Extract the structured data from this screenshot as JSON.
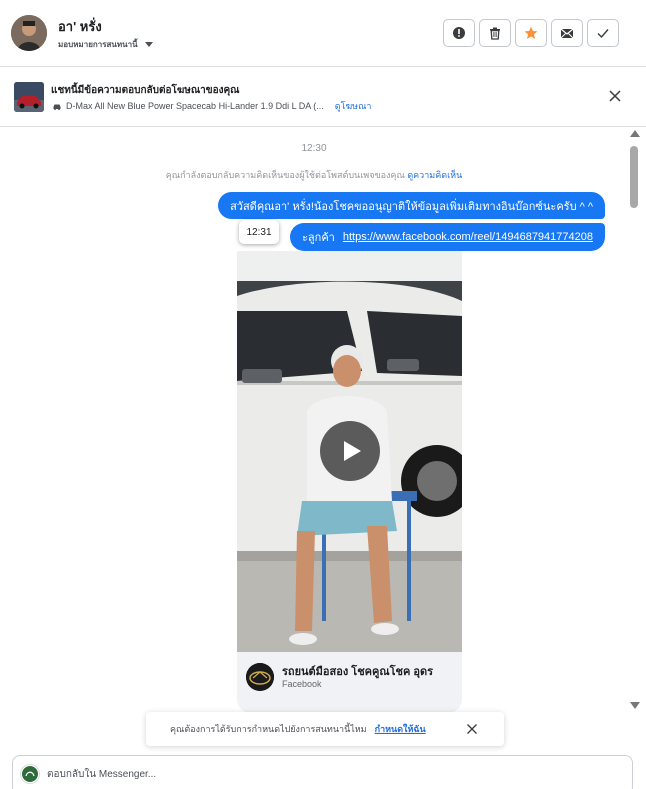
{
  "header": {
    "contact_name": "อา' หรั่ง",
    "assign_label": "มอบหมายการสนทนานี้",
    "actions": [
      {
        "id": "spam",
        "icon": "alert-icon"
      },
      {
        "id": "delete",
        "icon": "trash-icon"
      },
      {
        "id": "star",
        "icon": "star-icon",
        "color": "#f7923b"
      },
      {
        "id": "unread",
        "icon": "mail-icon"
      },
      {
        "id": "done",
        "icon": "check-icon"
      }
    ]
  },
  "ad_bar": {
    "title": "แชทนี้มีข้อความตอบกลับต่อโฆษณาของคุณ",
    "ad_name": "D-Max All New Blue Power Spacecab Hi-Lander 1.9 Ddi L DA (...",
    "view_ad_label": "ดูโฆษณา"
  },
  "chat": {
    "timestamp": "12:30",
    "notice_text": "คุณกำลังตอบกลับความคิดเห็นของผู้ใช้ต่อโพสต์บนเพจของคุณ",
    "notice_link": "ดูความคิดเห็น",
    "messages": [
      {
        "text": "สวัสดีคุณอา' หรั่ง!น้องโชคขออนุญาติให้ข้อมูลเพิ่มเติมทางอินบ๊อกซ์นะครับ ^ ^"
      },
      {
        "prefix": "ะลูกค้า",
        "url": "https://www.facebook.com/reel/1494687941774208"
      }
    ],
    "tooltip_time": "12:31",
    "video_card": {
      "page_name": "รถยนต์มือสอง โชคคูณโชค อุดร",
      "source": "Facebook"
    }
  },
  "snooze": {
    "text": "คุณต้องการได้รับการกำหนดไปยังการสนทนานี้ไหม",
    "link": "กำหนดให้ฉัน"
  },
  "composer": {
    "placeholder": "ตอบกลับใน Messenger..."
  },
  "colors": {
    "accent": "#1877f2",
    "link": "#216fdb",
    "star": "#f7923b"
  }
}
